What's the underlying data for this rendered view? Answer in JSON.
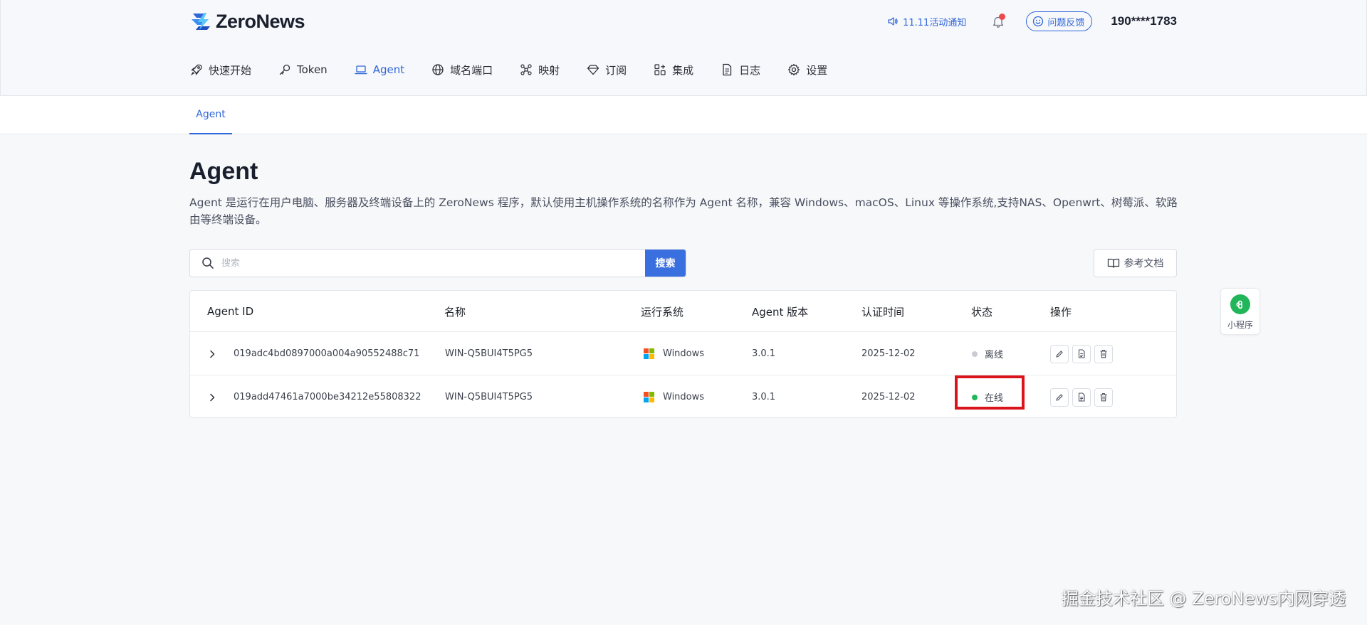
{
  "app": {
    "logo_text": "ZeroNews"
  },
  "header": {
    "notice": "11.11活动通知",
    "feedback": "问题反馈",
    "phone": "190****1783"
  },
  "nav": [
    {
      "label": "快速开始",
      "icon": "rocket-icon"
    },
    {
      "label": "Token",
      "icon": "key-icon"
    },
    {
      "label": "Agent",
      "icon": "laptop-icon",
      "active": true
    },
    {
      "label": "域名端口",
      "icon": "globe-icon"
    },
    {
      "label": "映射",
      "icon": "mapping-icon"
    },
    {
      "label": "订阅",
      "icon": "diamond-icon"
    },
    {
      "label": "集成",
      "icon": "grid-icon"
    },
    {
      "label": "日志",
      "icon": "document-icon"
    },
    {
      "label": "设置",
      "icon": "gear-icon"
    }
  ],
  "subtab": "Agent",
  "page": {
    "title": "Agent",
    "description": "Agent 是运行在用户电脑、服务器及终端设备上的 ZeroNews 程序，默认使用主机操作系统的名称作为 Agent 名称，兼容 Windows、macOS、Linux 等操作系统,支持NAS、Openwrt、树莓派、软路由等终端设备。"
  },
  "search": {
    "placeholder": "搜索",
    "value": "",
    "button": "搜索"
  },
  "doc_button": "参考文档",
  "table": {
    "columns": [
      "Agent ID",
      "名称",
      "运行系统",
      "Agent 版本",
      "认证时间",
      "状态",
      "操作"
    ],
    "rows": [
      {
        "id": "019adc4bd0897000a004a90552488c71",
        "name": "WIN-Q5BUI4T5PG5",
        "os": "Windows",
        "version": "3.0.1",
        "auth_time": "2025-12-02",
        "status": "离线",
        "status_color": "#c9ccd2"
      },
      {
        "id": "019add47461a7000be34212e55808322",
        "name": "WIN-Q5BUI4T5PG5",
        "os": "Windows",
        "version": "3.0.1",
        "auth_time": "2025-12-02",
        "status": "在线",
        "status_color": "#21b65a"
      }
    ]
  },
  "mini_program": "小程序",
  "watermark": "掘金技术社区 @ ZeroNews内网穿透",
  "colors": {
    "accent": "#2f66d9",
    "online": "#21b65a",
    "offline": "#c9ccd2",
    "highlight": "#d9151b"
  }
}
